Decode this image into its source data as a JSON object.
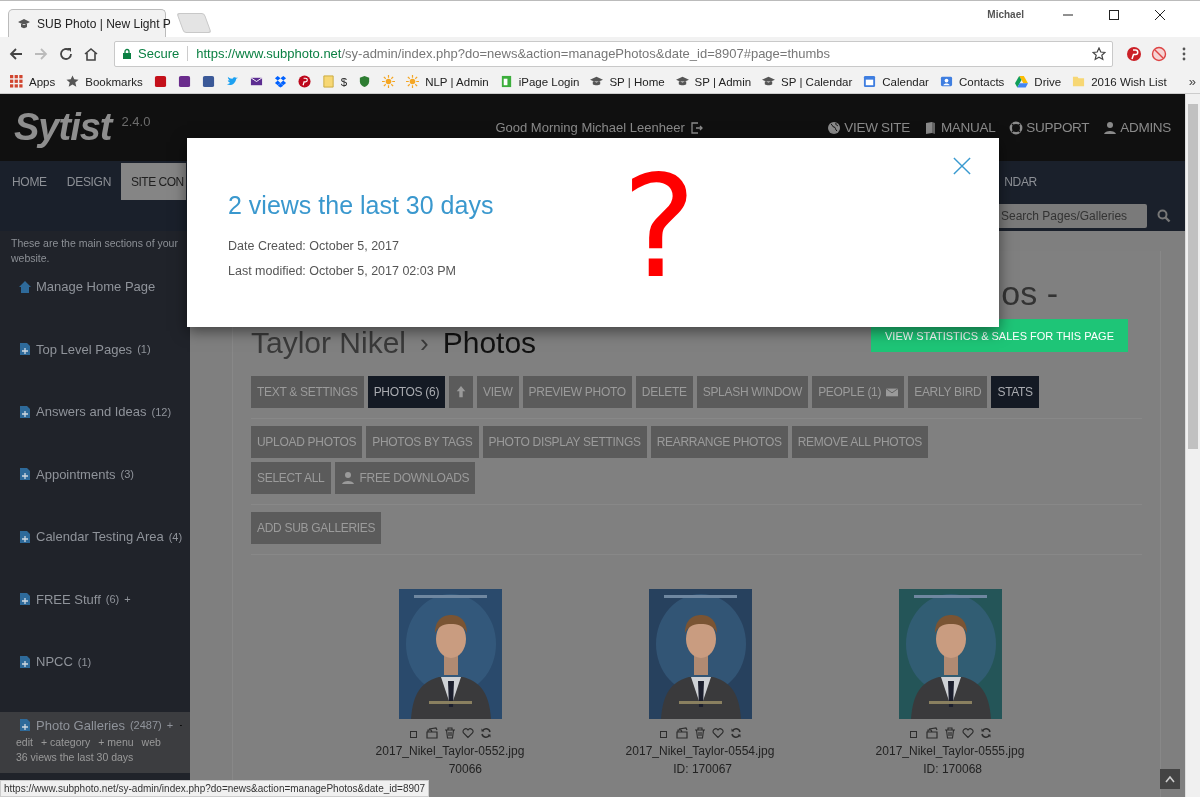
{
  "browser": {
    "tab_title": "SUB Photo | New Light P",
    "user": "Michael",
    "secure_label": "Secure",
    "url_host": "https://www.subphoto.net",
    "url_path": "/sy-admin/index.php?do=news&action=managePhotos&date_id=8907#page=thumbs",
    "overflow": "»",
    "bookmarks": [
      {
        "kind": "apps",
        "label": "Apps"
      },
      {
        "kind": "star",
        "label": "Bookmarks"
      },
      {
        "kind": "tile",
        "color": "#c4101a"
      },
      {
        "kind": "tile",
        "color": "#6a2c8c"
      },
      {
        "kind": "tile",
        "color": "#3b5998"
      },
      {
        "kind": "bird",
        "color": "#1da1f2"
      },
      {
        "kind": "envelope",
        "color": "#5c2d91"
      },
      {
        "kind": "box",
        "color": "#0061ff"
      },
      {
        "kind": "pin",
        "color": "#bd081c"
      },
      {
        "kind": "note",
        "label": "$"
      },
      {
        "kind": "shield",
        "color": "#2e7d32"
      },
      {
        "kind": "sun",
        "color": "#f5a623"
      },
      {
        "kind": "sun",
        "color": "#f5a623",
        "label": "NLP | Admin"
      },
      {
        "kind": "page",
        "color": "#3cae3c",
        "label": "iPage Login"
      },
      {
        "kind": "cap",
        "label": "SP | Home"
      },
      {
        "kind": "cap",
        "label": "SP | Admin"
      },
      {
        "kind": "cap",
        "label": "SP | Calendar"
      },
      {
        "kind": "calendar",
        "label": "Calendar"
      },
      {
        "kind": "contacts",
        "label": "Contacts"
      },
      {
        "kind": "drive",
        "label": "Drive"
      },
      {
        "kind": "folder",
        "label": "2016 Wish List"
      }
    ]
  },
  "site": {
    "logo": "Sytist",
    "version": "2.4.0",
    "greeting": "Good Morning Michael Leenheer",
    "links": [
      {
        "label": "VIEW SITE",
        "kind": "globe"
      },
      {
        "label": "MANUAL",
        "kind": "book"
      },
      {
        "label": "SUPPORT",
        "kind": "lifebuoy"
      },
      {
        "label": "ADMINS",
        "kind": "user"
      }
    ],
    "nav": [
      {
        "label": "HOME",
        "selected": false
      },
      {
        "label": "DESIGN",
        "selected": false
      },
      {
        "label": "SITE CON",
        "selected": true
      },
      {
        "label": "NDAR",
        "selected": false
      }
    ],
    "search": {
      "placeholder": "Search Pages/Galleries"
    }
  },
  "sidebar": {
    "intro": "These are the main sections of your website.",
    "items": [
      {
        "label": "Manage Home Page",
        "kind": "home",
        "selected": false
      },
      {
        "label": "Top Level Pages",
        "count": "(1)",
        "kind": "page",
        "selected": false
      },
      {
        "label": "Answers and Ideas",
        "count": "(12)",
        "kind": "page",
        "selected": false
      },
      {
        "label": "Appointments",
        "count": "(3)",
        "kind": "page",
        "selected": false
      },
      {
        "label": "Calendar Testing Area",
        "count": "(4)",
        "kind": "page",
        "selected": false
      },
      {
        "label": "FREE Stuff",
        "count": "(6)",
        "suffix": "+",
        "kind": "page",
        "selected": false
      },
      {
        "label": "NPCC",
        "count": "(1)",
        "kind": "page",
        "selected": false
      },
      {
        "label": "Photo Galleries",
        "count": "(2487)",
        "suffix": "+",
        "kind": "page",
        "selected": true,
        "links": [
          "edit",
          "+ category",
          "+ menu",
          "web"
        ],
        "stat": "36 views the last 30 days"
      }
    ]
  },
  "main": {
    "heading_tail": "os -",
    "crumb": "Taylor Nikel",
    "separator": "›",
    "page": "Photos",
    "stats_button": "VIEW STATISTICS & SALES FOR THIS PAGE",
    "tabs": [
      {
        "kind": "text",
        "label": "TEXT & SETTINGS",
        "selected": false
      },
      {
        "kind": "text",
        "label": "PHOTOS (6)",
        "selected": true
      },
      {
        "kind": "arrow",
        "selected": false
      },
      {
        "kind": "text",
        "label": "VIEW",
        "selected": false
      },
      {
        "kind": "text",
        "label": "PREVIEW PHOTO",
        "selected": false
      },
      {
        "kind": "text",
        "label": "DELETE",
        "selected": false
      },
      {
        "kind": "text",
        "label": "SPLASH WINDOW",
        "selected": false
      },
      {
        "kind": "mail",
        "label": "PEOPLE (1)",
        "selected": false
      },
      {
        "kind": "text",
        "label": "EARLY BIRD",
        "selected": false
      },
      {
        "kind": "text",
        "label": "STATS",
        "selected": true
      }
    ],
    "actions": [
      {
        "kind": "text",
        "label": "UPLOAD PHOTOS"
      },
      {
        "kind": "text",
        "label": "PHOTOS BY TAGS"
      },
      {
        "kind": "text",
        "label": "PHOTO DISPLAY SETTINGS"
      },
      {
        "kind": "text",
        "label": "REARRANGE PHOTOS"
      },
      {
        "kind": "text",
        "label": "REMOVE ALL PHOTOS"
      },
      {
        "kind": "text",
        "label": "SELECT ALL"
      },
      {
        "kind": "user",
        "label": "FREE DOWNLOADS"
      }
    ],
    "sub_button": "ADD SUB GALLERIES",
    "photos": [
      {
        "file": "2017_Nikel_Taylor-0552.jpg",
        "id": "70066",
        "checked": false
      },
      {
        "file": "2017_Nikel_Taylor-0554.jpg",
        "id": "ID: 170067",
        "checked": false
      },
      {
        "file": "2017_Nikel_Taylor-0555.jpg",
        "id": "ID: 170068",
        "checked": false
      }
    ]
  },
  "modal": {
    "title": "2 views the last 30 days",
    "created": "Date Created: October 5, 2017",
    "modified": "Last modified: October 5, 2017 02:03 PM",
    "annotation": "?"
  },
  "status_url": "https://www.subphoto.net/sy-admin/index.php?do=news&action=managePhotos&date_id=8907"
}
